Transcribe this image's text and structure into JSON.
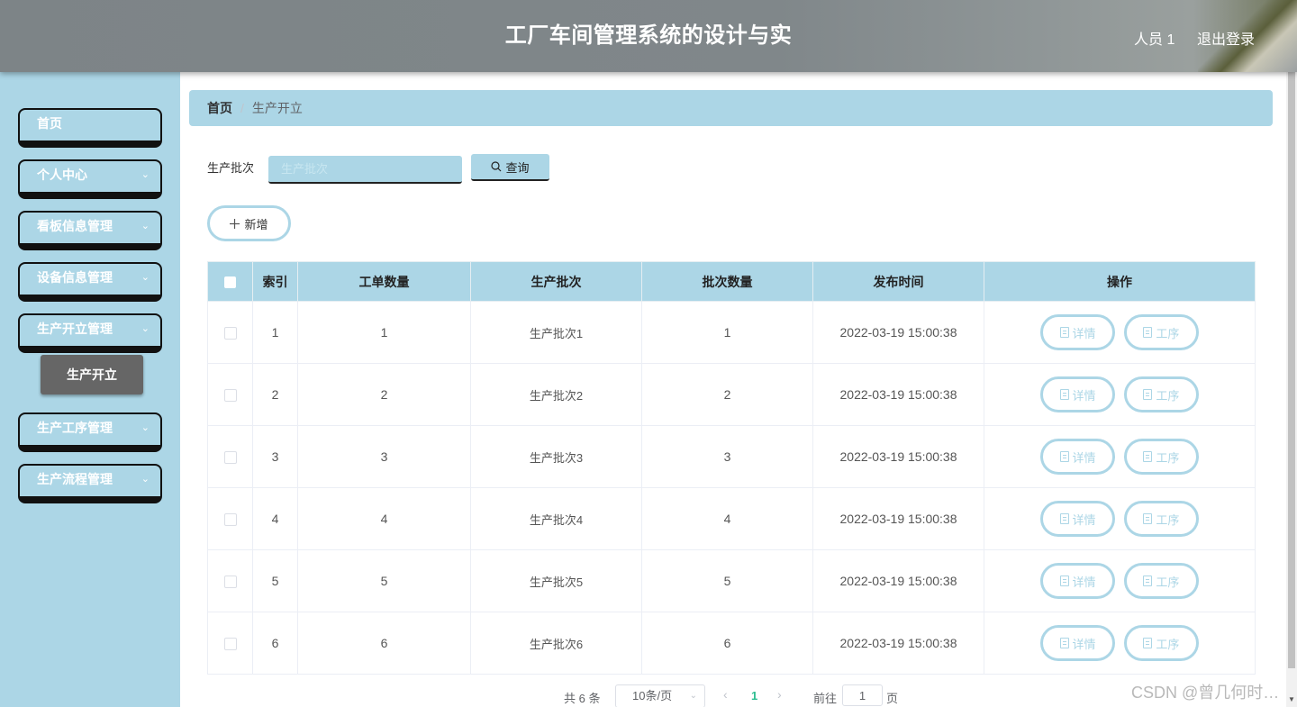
{
  "header": {
    "title": "工厂车间管理系统的设计与实",
    "user": "人员 1",
    "logout": "退出登录"
  },
  "sidebar": {
    "items": [
      {
        "label": "首页",
        "has_arrow": false
      },
      {
        "label": "个人中心",
        "has_arrow": true
      },
      {
        "label": "看板信息管理",
        "has_arrow": true
      },
      {
        "label": "设备信息管理",
        "has_arrow": true
      },
      {
        "label": "生产开立管理",
        "has_arrow": true
      },
      {
        "label": "生产工序管理",
        "has_arrow": true
      },
      {
        "label": "生产流程管理",
        "has_arrow": true
      }
    ],
    "active_sub": "生产开立",
    "arrow_glyph": "⌄"
  },
  "breadcrumb": {
    "home": "首页",
    "separator": "/",
    "current": "生产开立"
  },
  "search": {
    "label": "生产批次",
    "placeholder": "生产批次",
    "value": "",
    "query_label": "查询"
  },
  "toolbar": {
    "add_label": "新增"
  },
  "table": {
    "headers": [
      "索引",
      "工单数量",
      "生产批次",
      "批次数量",
      "发布时间",
      "操作"
    ],
    "rows": [
      {
        "index": "1",
        "qty": "1",
        "batch": "生产批次1",
        "batch_qty": "1",
        "time": "2022-03-19 15:00:38"
      },
      {
        "index": "2",
        "qty": "2",
        "batch": "生产批次2",
        "batch_qty": "2",
        "time": "2022-03-19 15:00:38"
      },
      {
        "index": "3",
        "qty": "3",
        "batch": "生产批次3",
        "batch_qty": "3",
        "time": "2022-03-19 15:00:38"
      },
      {
        "index": "4",
        "qty": "4",
        "batch": "生产批次4",
        "batch_qty": "4",
        "time": "2022-03-19 15:00:38"
      },
      {
        "index": "5",
        "qty": "5",
        "batch": "生产批次5",
        "batch_qty": "5",
        "time": "2022-03-19 15:00:38"
      },
      {
        "index": "6",
        "qty": "6",
        "batch": "生产批次6",
        "batch_qty": "6",
        "time": "2022-03-19 15:00:38"
      }
    ],
    "detail_label": "详情",
    "process_label": "工序"
  },
  "pagination": {
    "total": "共 6 条",
    "page_size": "10条/页",
    "current_page": "1",
    "goto_label": "前往",
    "goto_value": "1",
    "page_suffix": "页"
  },
  "watermark": "CSDN @曾几何时…",
  "colors": {
    "accent": "#acd6e6",
    "sub_item_bg": "#666666",
    "active_page": "#2dbd90"
  }
}
